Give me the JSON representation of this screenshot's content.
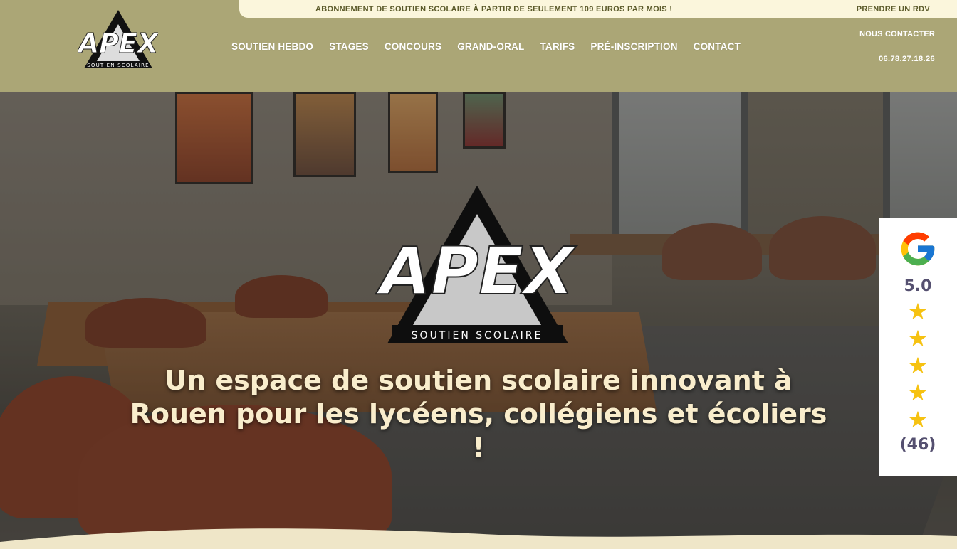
{
  "topbar": {
    "promo": "ABONNEMENT DE SOUTIEN SCOLAIRE À PARTIR DE SEULEMENT 109 EUROS PAR MOIS !",
    "rdv": "PRENDRE UN RDV"
  },
  "logo": {
    "word": "APEX",
    "tagline": "SOUTIEN SCOLAIRE"
  },
  "nav": [
    {
      "label": "SOUTIEN HEBDO"
    },
    {
      "label": "STAGES"
    },
    {
      "label": "CONCOURS"
    },
    {
      "label": "GRAND-ORAL"
    },
    {
      "label": "TARIFS"
    },
    {
      "label": "PRÉ-INSCRIPTION"
    },
    {
      "label": "CONTACT"
    }
  ],
  "contact": {
    "label": "NOUS CONTACTER",
    "phone": "06.78.27.18.26"
  },
  "hero": {
    "title": "Un espace de soutien scolaire innovant à Rouen pour les lycéens, collégiens et écoliers !"
  },
  "reviews": {
    "rating": "5.0",
    "stars": 5,
    "count": "(46)"
  },
  "colors": {
    "header": "#aba676",
    "topbar": "#fbf6dc",
    "title": "#f9edcc",
    "star": "#f6c211"
  }
}
